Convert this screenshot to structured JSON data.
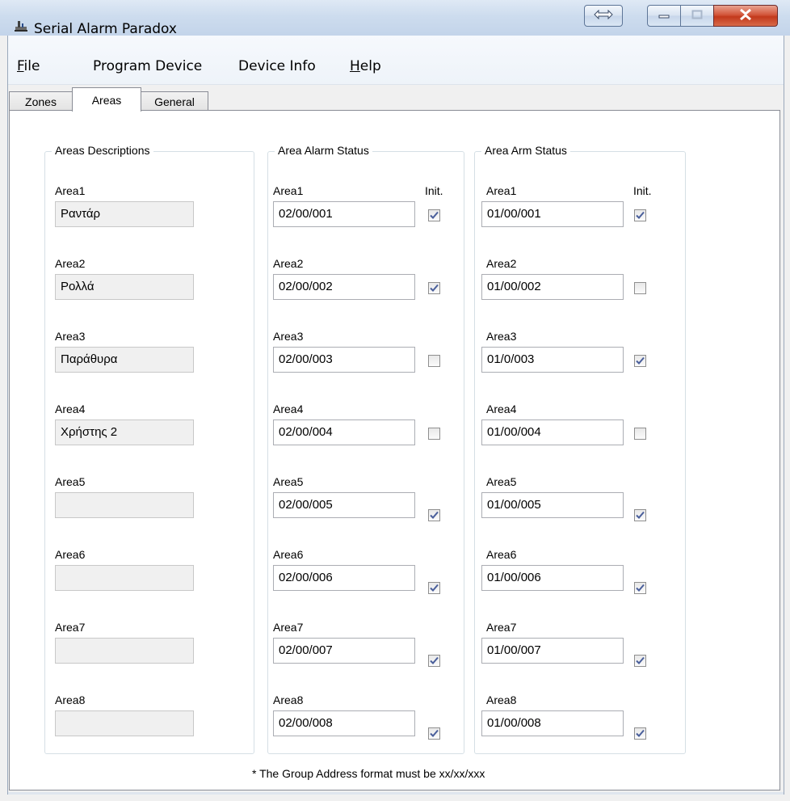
{
  "window": {
    "title": "Serial Alarm Paradox",
    "controls": {
      "swap_icon": "double-arrow-icon",
      "minimize_icon": "minimize-icon",
      "maximize_icon": "maximize-icon",
      "close_icon": "close-icon"
    }
  },
  "menu": {
    "file": {
      "u": "F",
      "rest": "ile"
    },
    "program_device": "Program Device",
    "device_info": "Device Info",
    "help": {
      "u": "H",
      "rest": "elp"
    }
  },
  "tabs": {
    "zones": "Zones",
    "areas": "Areas",
    "general": "General",
    "active": "Areas"
  },
  "descriptions": {
    "title": "Areas Descriptions",
    "items": [
      {
        "label": "Area1",
        "value": "Ραντάρ"
      },
      {
        "label": "Area2",
        "value": "Ρολλά"
      },
      {
        "label": "Area3",
        "value": "Παράθυρα"
      },
      {
        "label": "Area4",
        "value": "Χρήστης 2"
      },
      {
        "label": "Area5",
        "value": ""
      },
      {
        "label": "Area6",
        "value": ""
      },
      {
        "label": "Area7",
        "value": ""
      },
      {
        "label": "Area8",
        "value": ""
      }
    ]
  },
  "alarm_status": {
    "title": "Area Alarm Status",
    "init_label": "Init.",
    "items": [
      {
        "label": "Area1",
        "value": "02/00/001",
        "init": true
      },
      {
        "label": "Area2",
        "value": "02/00/002",
        "init": true
      },
      {
        "label": "Area3",
        "value": "02/00/003",
        "init": false
      },
      {
        "label": "Area4",
        "value": "02/00/004",
        "init": false
      },
      {
        "label": "Area5",
        "value": "02/00/005",
        "init": true
      },
      {
        "label": "Area6",
        "value": "02/00/006",
        "init": true
      },
      {
        "label": "Area7",
        "value": "02/00/007",
        "init": true
      },
      {
        "label": "Area8",
        "value": "02/00/008",
        "init": true
      }
    ]
  },
  "arm_status": {
    "title": "Area Arm Status",
    "init_label": "Init.",
    "items": [
      {
        "label": "Area1",
        "value": "01/00/001",
        "init": true
      },
      {
        "label": "Area2",
        "value": "01/00/002",
        "init": false
      },
      {
        "label": "Area3",
        "value": "01/0/003",
        "init": true
      },
      {
        "label": "Area4",
        "value": "01/00/004",
        "init": false
      },
      {
        "label": "Area5",
        "value": "01/00/005",
        "init": true
      },
      {
        "label": "Area6",
        "value": "01/00/006",
        "init": true
      },
      {
        "label": "Area7",
        "value": "01/00/007",
        "init": true
      },
      {
        "label": "Area8",
        "value": "01/00/008",
        "init": true
      }
    ]
  },
  "footnote": "* The Group Address format must be xx/xx/xxx",
  "colors": {
    "check": "#4a5f9b",
    "accent": "#3d95ff"
  }
}
